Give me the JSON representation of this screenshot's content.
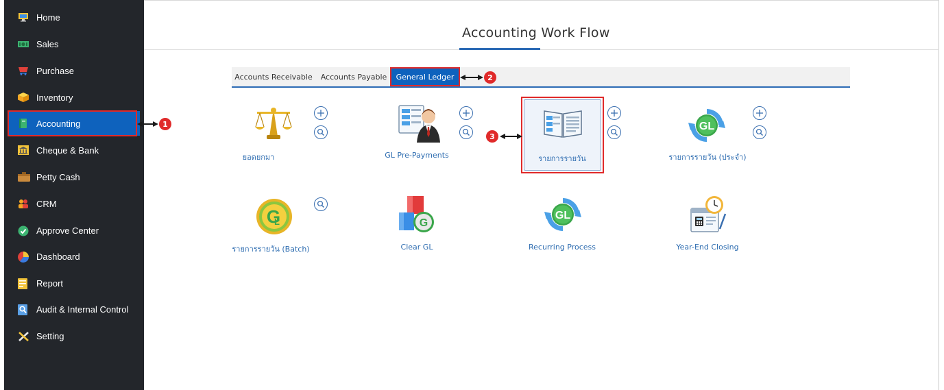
{
  "sidebar": {
    "items": [
      {
        "label": "Home"
      },
      {
        "label": "Sales"
      },
      {
        "label": "Purchase"
      },
      {
        "label": "Inventory"
      },
      {
        "label": "Accounting"
      },
      {
        "label": "Cheque & Bank"
      },
      {
        "label": "Petty Cash"
      },
      {
        "label": "CRM"
      },
      {
        "label": "Approve Center"
      },
      {
        "label": "Dashboard"
      },
      {
        "label": "Report"
      },
      {
        "label": "Audit & Internal Control"
      },
      {
        "label": "Setting"
      }
    ],
    "active": "Accounting"
  },
  "header": {
    "title": "Accounting Work Flow"
  },
  "tabs": [
    {
      "label": "Accounts Receivable"
    },
    {
      "label": "Accounts Payable"
    },
    {
      "label": "General Ledger"
    }
  ],
  "modules": {
    "row1": [
      {
        "label": "ยอดยกมา"
      },
      {
        "label": "GL Pre-Payments"
      },
      {
        "label": "รายการรายวัน"
      },
      {
        "label": "รายการรายวัน (ประจำ)"
      }
    ],
    "row2": [
      {
        "label": "รายการรายวัน (Batch)"
      },
      {
        "label": "Clear GL"
      },
      {
        "label": "Recurring Process"
      },
      {
        "label": "Year-End Closing"
      }
    ]
  },
  "callouts": [
    "1",
    "2",
    "3"
  ],
  "colors": {
    "sidebar_bg": "#23262b",
    "active_bg": "#0e62bd",
    "accent": "#2c6bb5",
    "callout": "#e02a2a"
  },
  "icons": {
    "sidebar": [
      "monitor-icon",
      "money-icon",
      "cart-icon",
      "box-icon",
      "book-icon",
      "bank-icon",
      "wallet-icon",
      "people-icon",
      "check-icon",
      "pie-chart-icon",
      "report-icon",
      "magnifier-doc-icon",
      "tools-icon"
    ],
    "modules": [
      "scales-icon",
      "person-ledger-icon",
      "open-book-icon",
      "gl-cycle-icon",
      "gl-yellow-icon",
      "blocks-gl-icon",
      "gl-green-icon",
      "calendar-clock-icon"
    ]
  }
}
